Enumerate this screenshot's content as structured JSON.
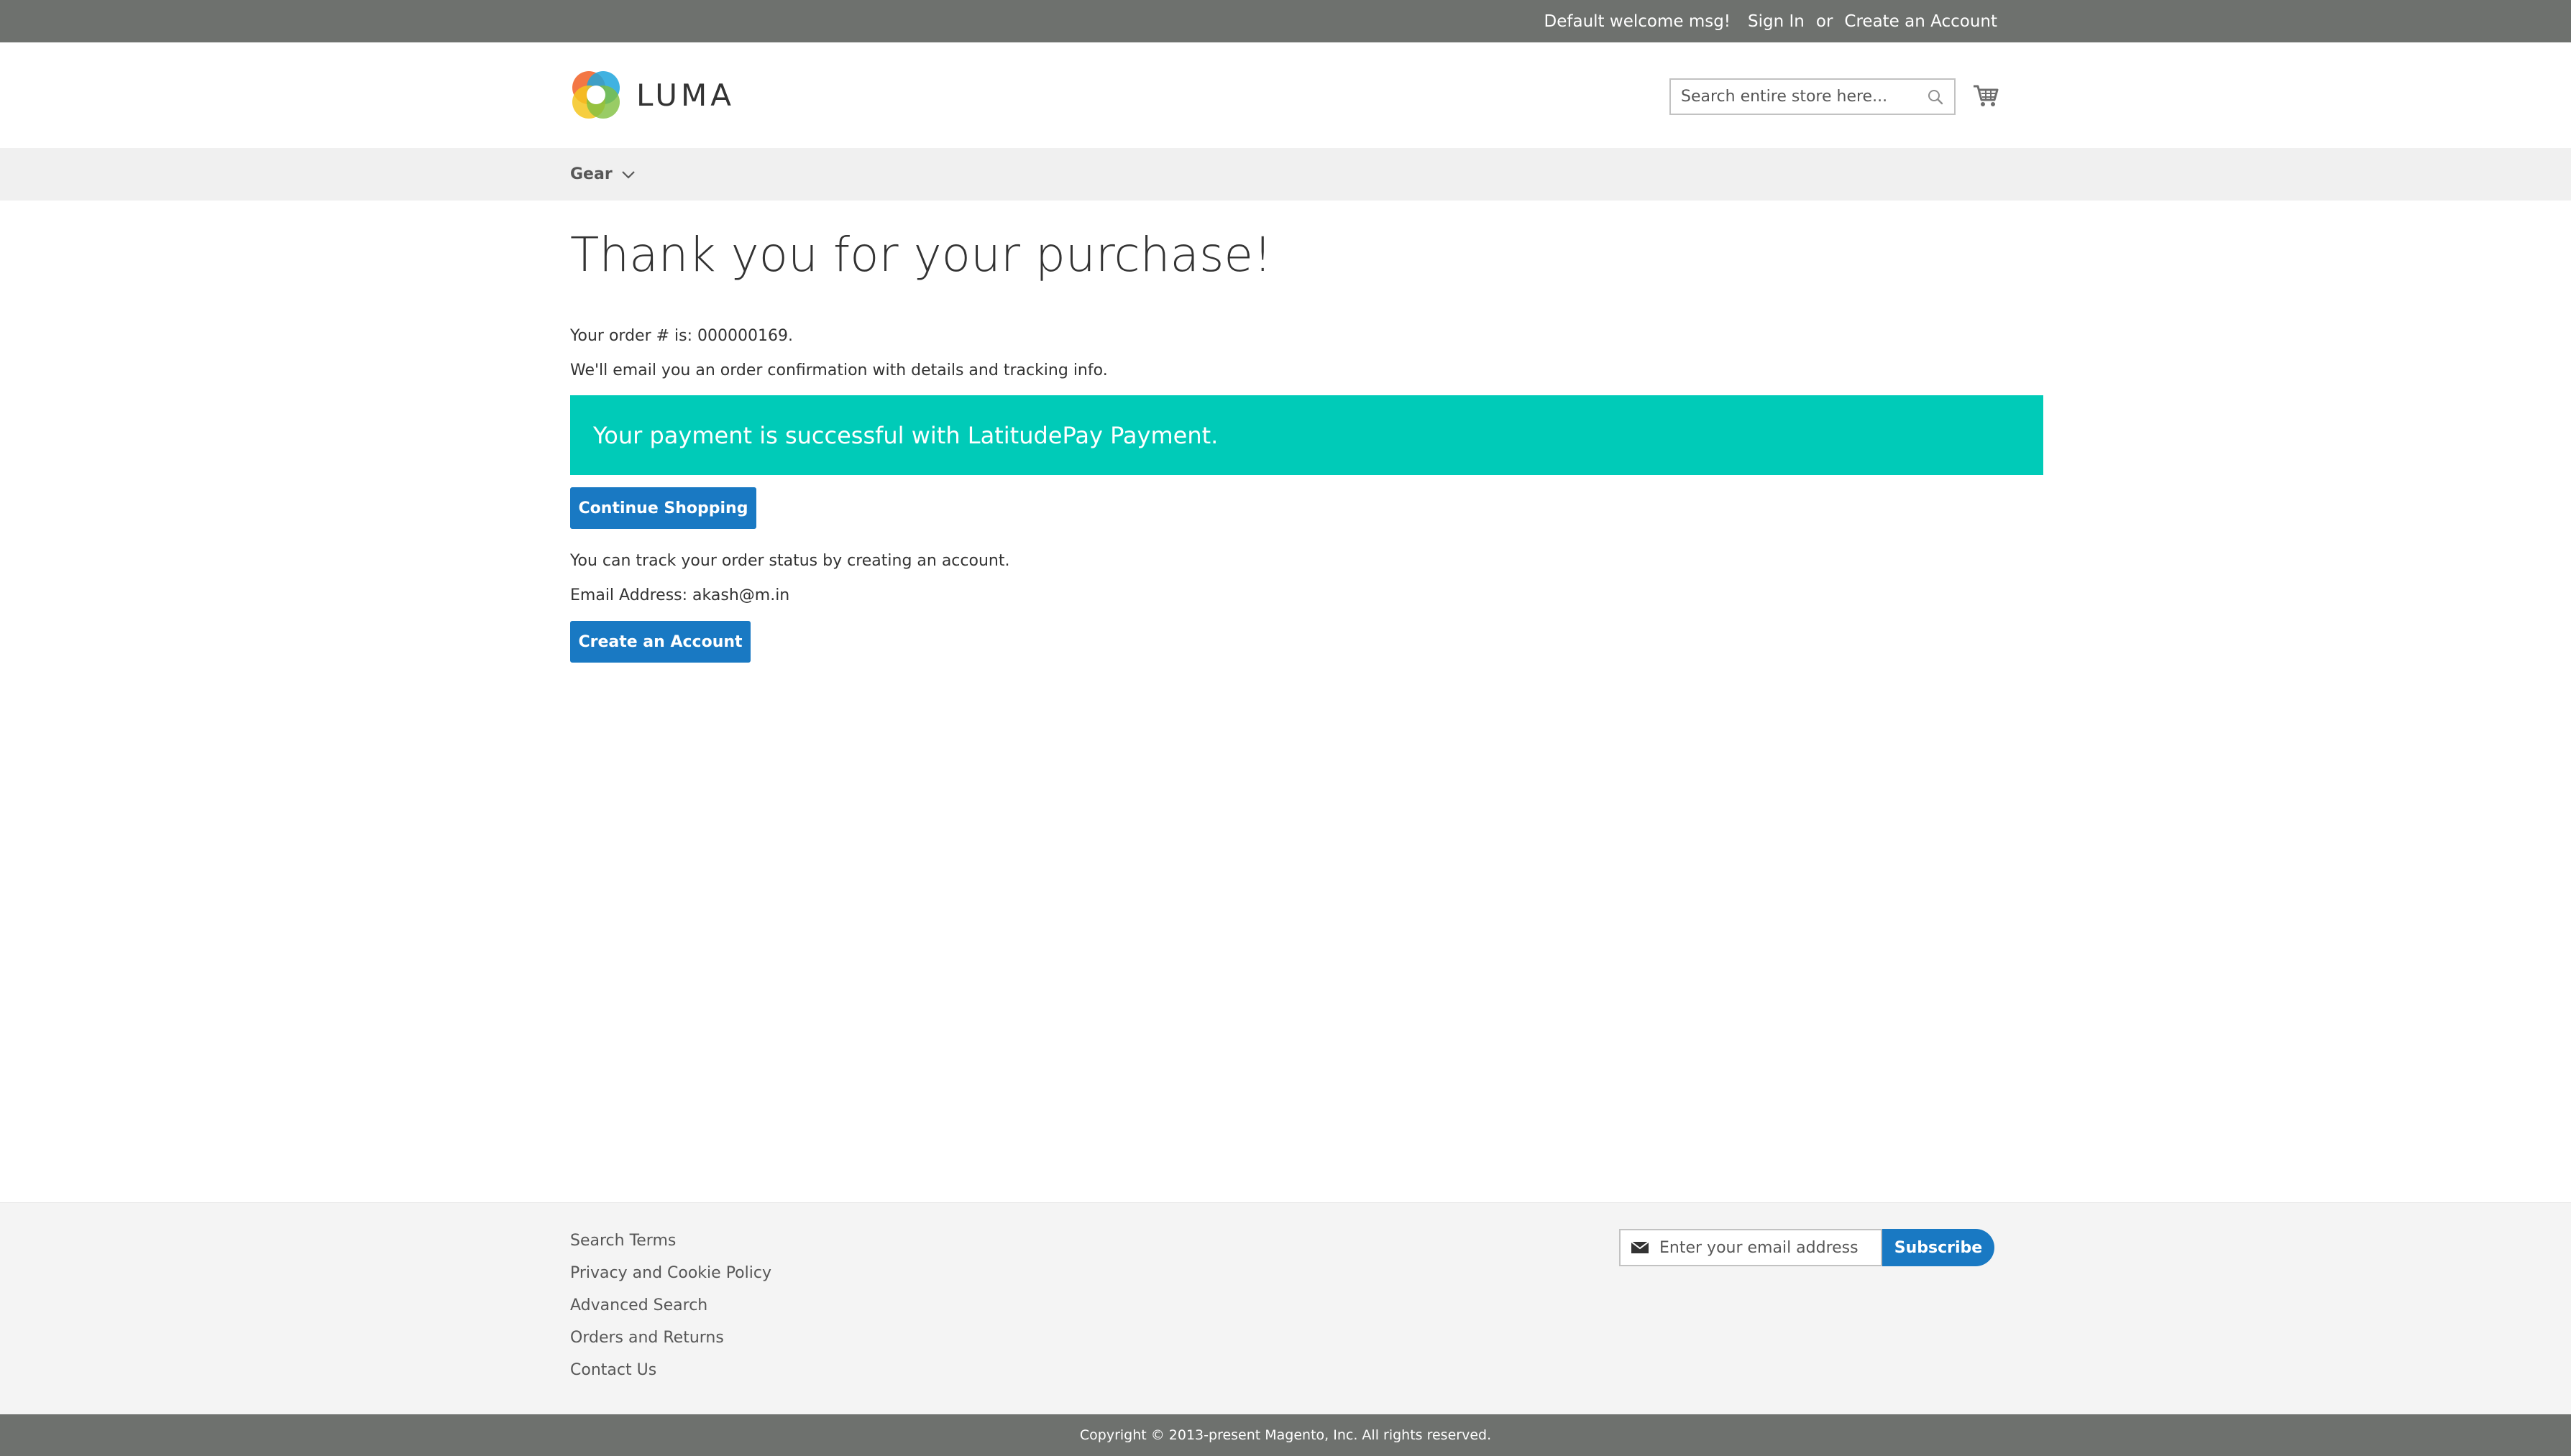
{
  "header": {
    "welcome": "Default welcome msg!",
    "sign_in": "Sign In",
    "or": "or",
    "create_account": "Create an Account",
    "logo_text": "LUMA",
    "search_placeholder": "Search entire store here..."
  },
  "nav": {
    "items": [
      {
        "label": "Gear"
      }
    ]
  },
  "main": {
    "title": "Thank you for your purchase!",
    "order_text": "Your order # is: 000000169.",
    "confirm_text": "We'll email you an order confirmation with details and tracking info.",
    "success_message": "Your payment is successful with LatitudePay Payment.",
    "continue_button": "Continue Shopping",
    "track_text": "You can track your order status by creating an account.",
    "email_text": "Email Address: akash@m.in",
    "create_account_button": "Create an Account"
  },
  "footer": {
    "links": [
      "Search Terms",
      "Privacy and Cookie Policy",
      "Advanced Search",
      "Orders and Returns",
      "Contact Us"
    ],
    "newsletter_placeholder": "Enter your email address",
    "subscribe_label": "Subscribe",
    "copyright": "Copyright © 2013-present Magento, Inc. All rights reserved."
  },
  "colors": {
    "top_bar": "#6e716e",
    "nav_bar": "#f0f0f0",
    "success": "#00cbb8",
    "primary_button": "#1979c3",
    "footer": "#f4f4f4"
  },
  "icons": [
    "search-icon",
    "cart-icon",
    "chevron-down-icon",
    "envelope-icon",
    "luma-logo"
  ]
}
